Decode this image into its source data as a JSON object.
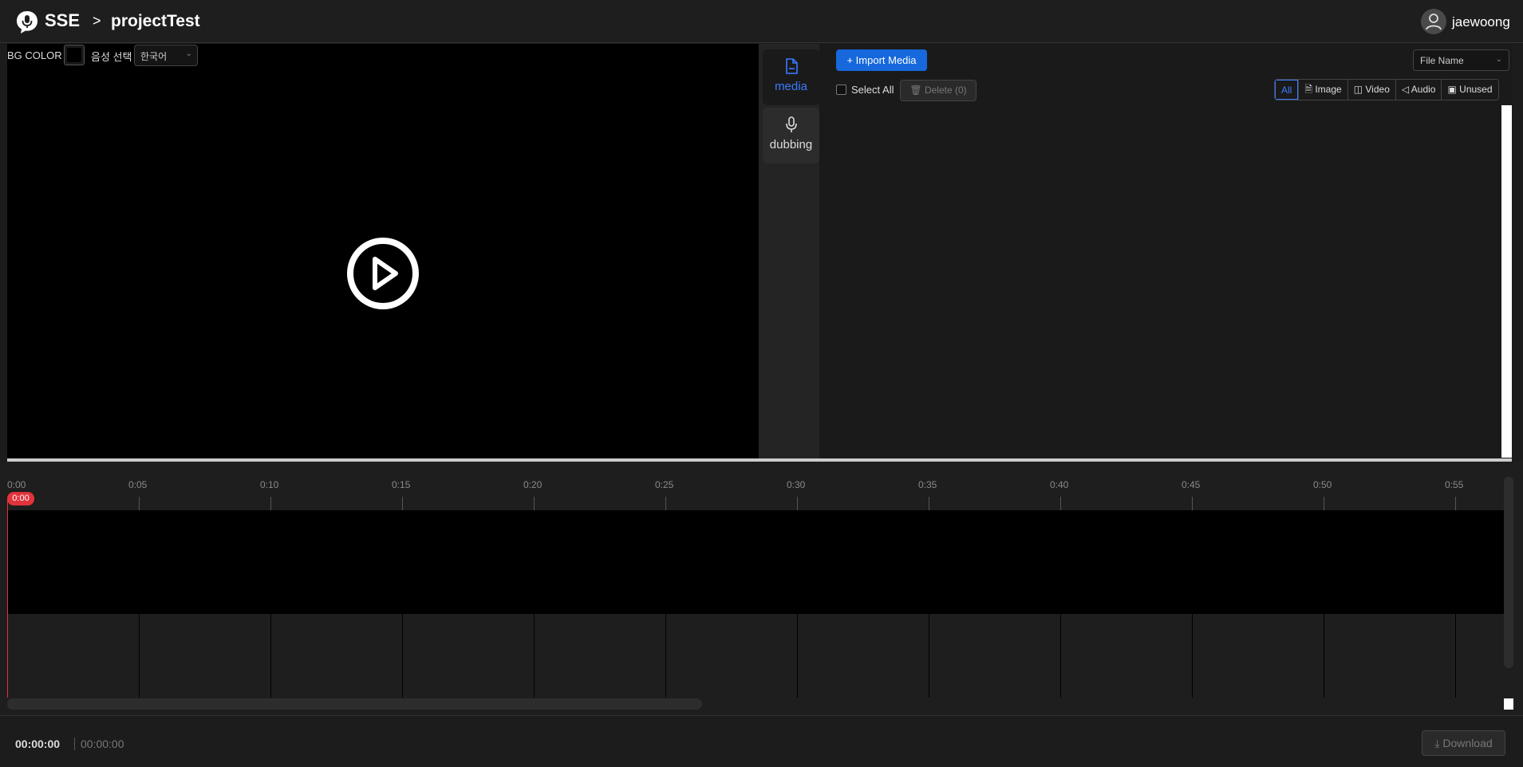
{
  "header": {
    "brand": "SSE",
    "breadcrumb_separator": ">",
    "project_title": "projectTest",
    "username": "jaewoong"
  },
  "preview_toolbar": {
    "bg_color_label": "BG COLOR",
    "bg_color_value": "#000000",
    "voice_label": "음성 선택",
    "voice_value": "한국어"
  },
  "side_tabs": [
    {
      "label": "media",
      "icon": "file-icon",
      "active": true
    },
    {
      "label": "dubbing",
      "icon": "microphone-icon",
      "active": false
    }
  ],
  "media_panel": {
    "import_label": "Import Media",
    "sort_value": "File Name",
    "select_all_label": "Select All",
    "delete_label": "Delete (0)",
    "filters": [
      {
        "label": "All",
        "icon": "",
        "active": true
      },
      {
        "label": "Image",
        "icon": "image-file-icon",
        "active": false
      },
      {
        "label": "Video",
        "icon": "video-icon",
        "active": false
      },
      {
        "label": "Audio",
        "icon": "speaker-icon",
        "active": false
      },
      {
        "label": "Unused",
        "icon": "unused-icon",
        "active": false
      }
    ]
  },
  "timeline": {
    "ticks": [
      "0:00",
      "0:05",
      "0:10",
      "0:15",
      "0:20",
      "0:25",
      "0:30",
      "0:35",
      "0:40",
      "0:45",
      "0:50",
      "0:55"
    ],
    "playhead_label": "0:00"
  },
  "footer": {
    "current_time": "00:00:00",
    "total_time": "00:00:00",
    "download_label": "Download"
  },
  "colors": {
    "accent": "#1668dc",
    "active_tab": "#3a7bff",
    "playhead": "#e2333b"
  }
}
